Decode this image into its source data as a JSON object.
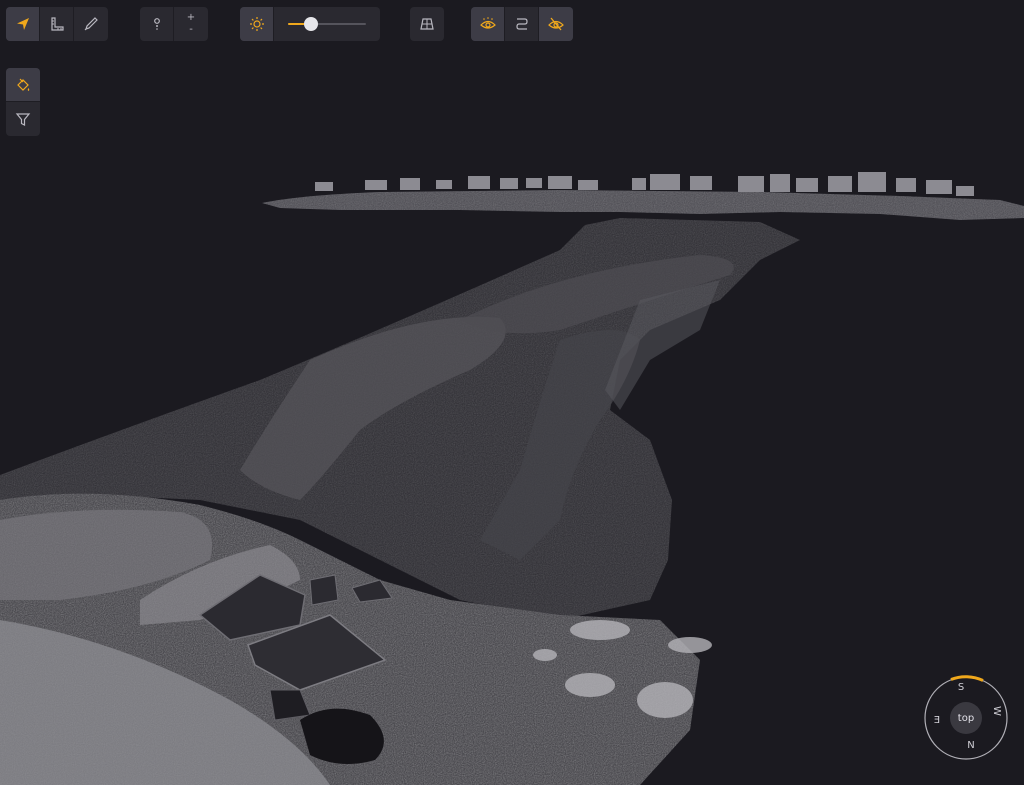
{
  "toolbar": {
    "navigation": [
      {
        "name": "select-arrow-icon",
        "active": true
      },
      {
        "name": "measure-ruler-icon",
        "active": false
      },
      {
        "name": "annotate-pen-icon",
        "active": false
      }
    ],
    "zoom": {
      "in_label": "+",
      "out_label": "-"
    },
    "brightness": {
      "value": 0.3
    },
    "view": [
      {
        "name": "perspective-grid-icon",
        "active": false
      }
    ],
    "visibility": [
      {
        "name": "eye-points-icon",
        "active": true
      },
      {
        "name": "path-curve-icon",
        "active": false
      },
      {
        "name": "hide-eye-icon",
        "active": true
      }
    ]
  },
  "sidebar": {
    "items": [
      {
        "name": "color-paint-icon",
        "active": true
      },
      {
        "name": "filter-icon",
        "active": false
      }
    ]
  },
  "compass": {
    "center_label": "top",
    "south": "S",
    "west": "W",
    "north": "N",
    "east": "E"
  },
  "colors": {
    "accent": "#f0a81c",
    "panel": "#2a2930",
    "background": "#1b1a20"
  }
}
